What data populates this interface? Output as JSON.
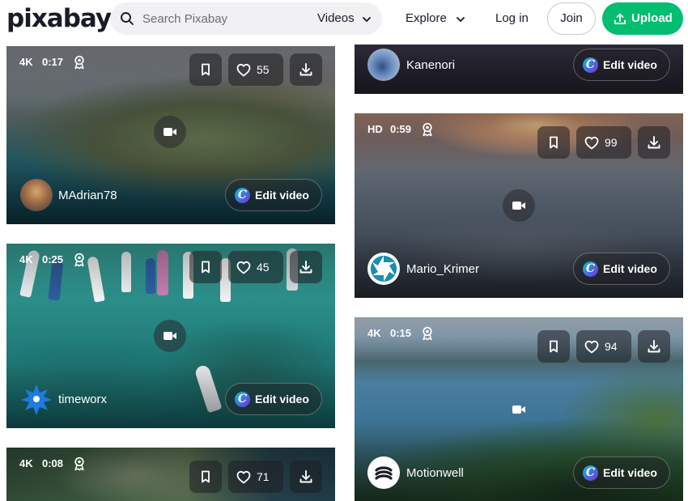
{
  "header": {
    "logo": "pixabay",
    "search_placeholder": "Search Pixabay",
    "search_type": "Videos",
    "explore": "Explore",
    "login": "Log in",
    "join": "Join",
    "upload": "Upload"
  },
  "colors": {
    "brand_green": "#02be6e",
    "text": "#191b26"
  },
  "cards": [
    {
      "quality": "4K",
      "duration": "0:17",
      "likes": "55",
      "user": "MAdrian78",
      "edit": "Edit video"
    },
    {
      "quality": "4K",
      "duration": "0:25",
      "likes": "45",
      "user": "timeworx",
      "edit": "Edit video"
    },
    {
      "quality": "4K",
      "duration": "0:08",
      "likes": "71"
    },
    {
      "user": "Kanenori",
      "edit": "Edit video"
    },
    {
      "quality": "HD",
      "duration": "0:59",
      "likes": "99",
      "user": "Mario_Krimer",
      "edit": "Edit video"
    },
    {
      "quality": "4K",
      "duration": "0:15",
      "likes": "94",
      "user": "Motionwell",
      "edit": "Edit video"
    }
  ]
}
